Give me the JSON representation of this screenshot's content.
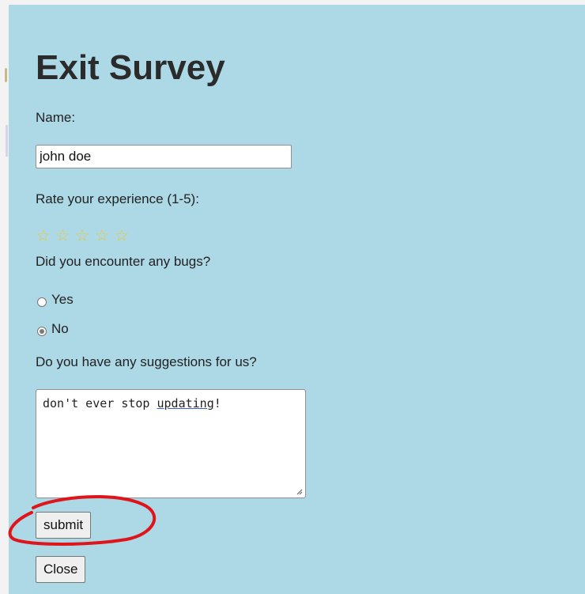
{
  "dialog": {
    "title": "Exit Survey"
  },
  "form": {
    "name_label": "Name:",
    "name_value": "john doe",
    "rating_label": "Rate your experience (1-5):",
    "rating": {
      "max": 5,
      "selected": 0,
      "star_glyph": "☆",
      "star_color": "#e8c83a"
    },
    "bugs_label": "Did you encounter any bugs?",
    "bugs_options": [
      {
        "label": "Yes",
        "checked": false
      },
      {
        "label": "No",
        "checked": true
      }
    ],
    "suggestions_label": "Do you have any suggestions for us?",
    "suggestions_value_plain": "don't ever stop ",
    "suggestions_value_underlined": "updating",
    "suggestions_value_end": "!"
  },
  "buttons": {
    "submit_label": "submit",
    "close_label": "Close"
  },
  "colors": {
    "dialog_background": "#add8e6",
    "annotation_red": "#e0141b"
  }
}
